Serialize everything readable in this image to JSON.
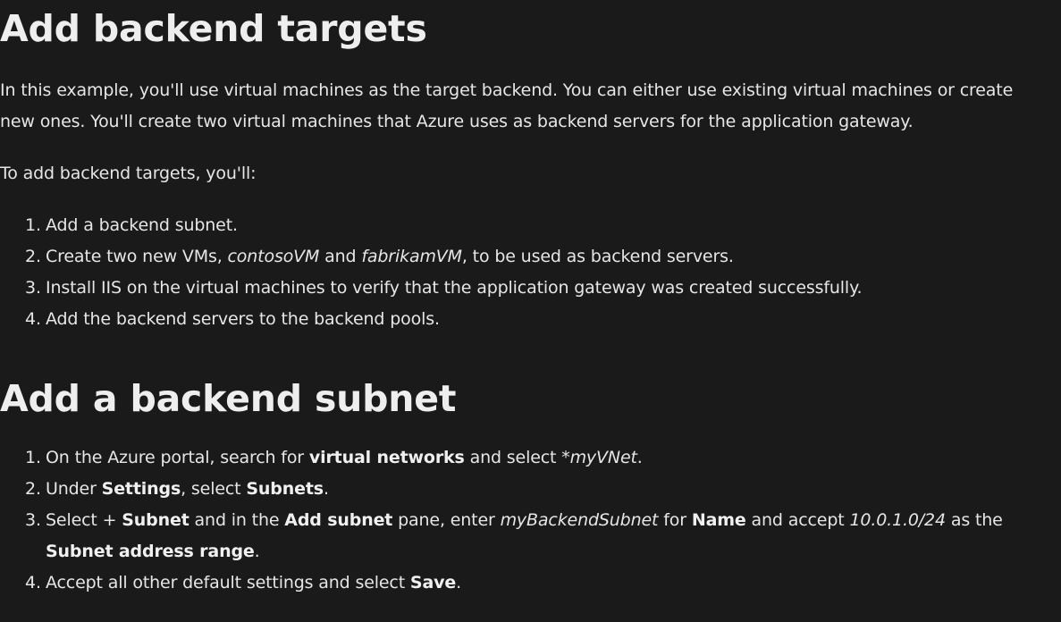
{
  "section1": {
    "title": "Add backend targets",
    "intro_line1": "In this example, you'll use virtual machines as the target backend. You can either use existing virtual machines or create",
    "intro_line2": "new ones. You'll create two virtual machines that Azure uses as backend servers for the application gateway.",
    "lead_in": "To add backend targets, you'll:",
    "steps": [
      {
        "num": "1.",
        "text": "Add a backend subnet."
      },
      {
        "num": "2.",
        "pre": "Create two new VMs, ",
        "em1": "contosoVM",
        "mid": " and ",
        "em2": "fabrikamVM",
        "post": ", to be used as backend servers."
      },
      {
        "num": "3.",
        "text": "Install IIS on the virtual machines to verify that the application gateway was created successfully."
      },
      {
        "num": "4.",
        "text": "Add the backend servers to the backend pools."
      }
    ]
  },
  "section2": {
    "title": "Add a backend subnet",
    "steps": [
      {
        "num": "1.",
        "a": "On the Azure portal, search for ",
        "b1": "virtual networks",
        "c": " and select *",
        "i1": "myVNet",
        "d": "."
      },
      {
        "num": "2.",
        "a": "Under ",
        "b1": "Settings",
        "c": ", select ",
        "b2": "Subnets",
        "d": "."
      },
      {
        "num": "3.",
        "a": "Select + ",
        "b1": "Subnet",
        "c": " and in the ",
        "b2": "Add subnet",
        "d": " pane, enter ",
        "i1": "myBackendSubnet",
        "e": " for ",
        "b3": "Name",
        "f": " and accept ",
        "i2": "10.0.1.0/24",
        "g": " as the",
        "b4": "Subnet address range",
        "h": "."
      },
      {
        "num": "4.",
        "a": "Accept all other default settings and select ",
        "b1": "Save",
        "d": "."
      }
    ]
  }
}
